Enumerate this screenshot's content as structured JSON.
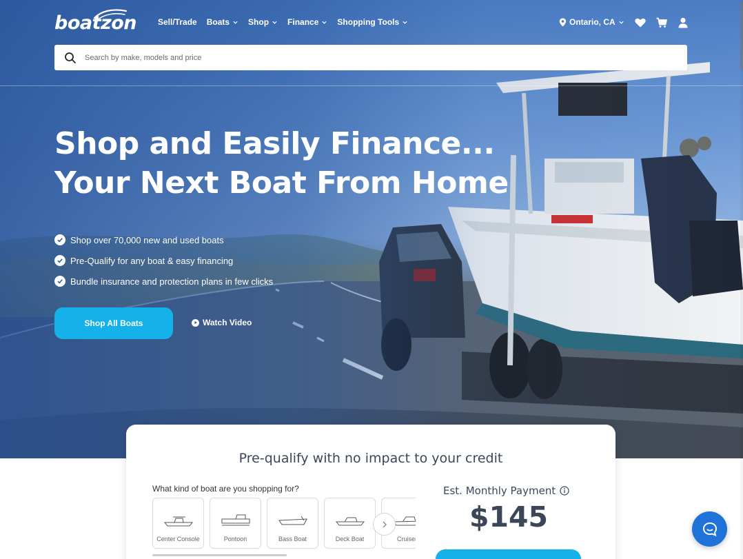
{
  "brand": {
    "logo_text": "boatzon"
  },
  "nav": {
    "items": [
      {
        "label": "Sell/Trade",
        "dropdown": false
      },
      {
        "label": "Boats",
        "dropdown": true
      },
      {
        "label": "Shop",
        "dropdown": true
      },
      {
        "label": "Finance",
        "dropdown": true
      },
      {
        "label": "Shopping Tools",
        "dropdown": true
      }
    ],
    "location": "Ontario, CA",
    "icons": [
      "location-pin-icon",
      "heart-icon",
      "cart-icon",
      "user-icon"
    ]
  },
  "search": {
    "placeholder": "Search by make, models and price"
  },
  "hero": {
    "headline_line1": "Shop and Easily Finance...",
    "headline_line2": "Your Next Boat From Home",
    "bullets": [
      "Shop over 70,000 new and used boats",
      "Pre-Qualify for any boat & easy financing",
      "Bundle insurance and protection plans in few clicks"
    ],
    "cta_label": "Shop All Boats",
    "video_label": "Watch Video"
  },
  "prequal": {
    "title": "Pre-qualify with no impact to your credit",
    "question": "What kind of boat are you shopping for?",
    "boat_types": [
      "Center Console",
      "Pontoon",
      "Bass Boat",
      "Deck Boat",
      "Cruiser"
    ],
    "est_label": "Est. Monthly Payment",
    "est_value": "$145"
  },
  "colors": {
    "accent": "#14b1ea",
    "heading": "#3c4659",
    "chat": "#1f73d8"
  }
}
